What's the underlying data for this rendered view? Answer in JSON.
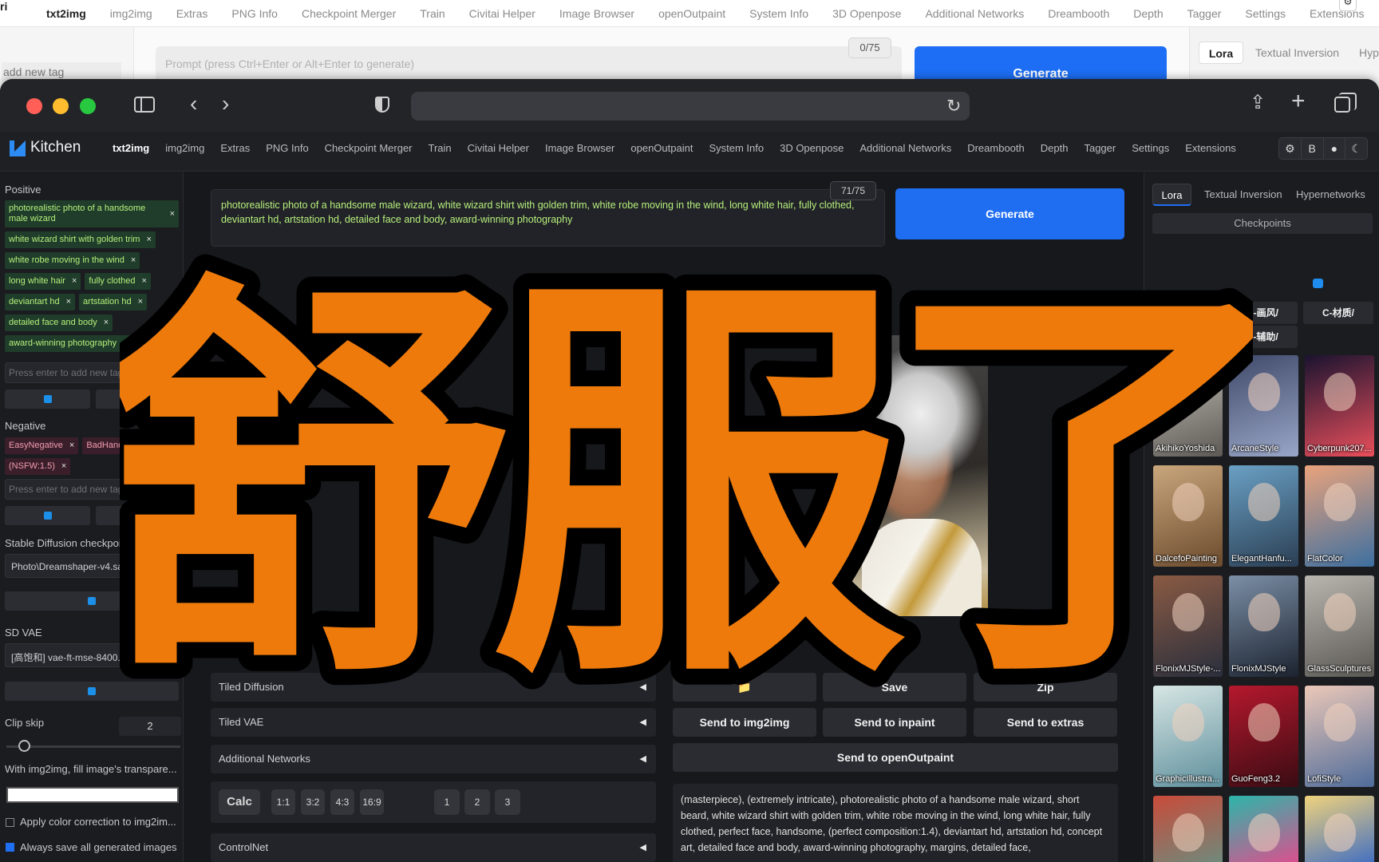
{
  "background_app": {
    "nav_edge": "ri",
    "nav": [
      "txt2img",
      "img2img",
      "Extras",
      "PNG Info",
      "Checkpoint Merger",
      "Train",
      "Civitai Helper",
      "Image Browser",
      "openOutpaint",
      "System Info",
      "3D Openpose",
      "Additional Networks",
      "Dreambooth",
      "Depth",
      "Tagger",
      "Settings",
      "Extensions"
    ],
    "add_tag": "add new tag",
    "prompt_placeholder": "Prompt (press Ctrl+Enter or Alt+Enter to generate)",
    "token_count": "0/75",
    "generate_label": "Generate",
    "tabs": [
      "Lora",
      "Textual Inversion",
      "Hyp"
    ]
  },
  "app": {
    "logo_text": "Kitchen",
    "nav": [
      "txt2img",
      "img2img",
      "Extras",
      "PNG Info",
      "Checkpoint Merger",
      "Train",
      "Civitai Helper",
      "Image Browser",
      "openOutpaint",
      "System Info",
      "3D Openpose",
      "Additional Networks",
      "Dreambooth",
      "Depth",
      "Tagger",
      "Settings",
      "Extensions"
    ],
    "nav_actions": [
      "⚙",
      "B",
      "●",
      "☾"
    ]
  },
  "left_panel": {
    "positive_label": "Positive",
    "positive_tags": [
      "photorealistic photo of a handsome male wizard",
      "white wizard shirt with golden trim",
      "white robe moving in the wind",
      "long white hair",
      "fully clothed",
      "deviantart hd",
      "artstation hd",
      "detailed face and body",
      "award-winning photography"
    ],
    "negative_label": "Negative",
    "negative_tags": [
      "EasyNegative",
      "BadHand",
      "(NSFW:1.5)"
    ],
    "tag_placeholder": "Press enter to add new tag",
    "checkpoint_label": "Stable Diffusion checkpoint",
    "checkpoint_value": "Photo\\Dreamshaper-v4.saf...",
    "vae_label": "SD VAE",
    "vae_value": "[高饱和] vae-ft-mse-8400...",
    "clip_skip_label": "Clip skip",
    "clip_skip_value": "2",
    "clip_skip_fraction": 0.1,
    "fill_label": "With img2img, fill image's transpare...",
    "fill_color": "#ffffff",
    "color_correction_label": "Apply color correction to img2im...",
    "color_correction_checked": false,
    "always_save_label": "Always save all generated images",
    "always_save_checked": true
  },
  "center_panel": {
    "prompt_text": "photorealistic photo of a handsome male wizard, white wizard shirt with golden trim, white robe moving in the wind, long white hair, fully clothed, deviantart hd, artstation hd, detailed face and body, award-winning photography",
    "token_count": "71/75",
    "generate_label": "Generate",
    "sections": [
      "Tiled Diffusion",
      "Tiled VAE",
      "Additional Networks",
      "ControlNet"
    ],
    "calc_label": "Calc",
    "ratio_buttons": [
      "1:1",
      "3:2",
      "4:3",
      "16:9"
    ],
    "number_buttons": [
      "1",
      "2",
      "3"
    ]
  },
  "output": {
    "folder_icon": "📁",
    "save_label": "Save",
    "zip_label": "Zip",
    "send_img2img": "Send to img2img",
    "send_inpaint": "Send to inpaint",
    "send_extras": "Send to extras",
    "send_outpaint": "Send to openOutpaint",
    "info_text": "(masterpiece), (extremely intricate), photorealistic photo of a handsome male wizard, short beard, white wizard shirt with golden trim, white robe moving in the wind, long white hair, fully clothed, perfect face, handsome, (perfect composition:1.4), deviantart hd, artstation hd, concept art, detailed face and body, award-winning photography, margins, detailed face,"
  },
  "right_panel": {
    "tabs": [
      "Lora",
      "Textual Inversion",
      "Hypernetworks"
    ],
    "checkpoints_label": "Checkpoints",
    "chips": [
      "B-画风/",
      "C-材质/",
      "E-辅助/"
    ],
    "cards": [
      "AkihikoYoshida",
      "ArcaneStyle",
      "Cyberpunk207...",
      "DalcefoPainting",
      "ElegantHanfu...",
      "FlatColor",
      "FlonixMJStyle-...",
      "FlonixMJStyle",
      "GlassSculptures",
      "GraphicIllustra...",
      "GuoFeng3.2",
      "LofiStyle",
      "",
      "",
      ""
    ],
    "card_colors": [
      [
        "#c9c4bd",
        "#5d5a55"
      ],
      [
        "#3f4a6a",
        "#9aa6c7"
      ],
      [
        "#1a1330",
        "#e94f5b"
      ],
      [
        "#c9a67c",
        "#6b4b2d"
      ],
      [
        "#6aa0c4",
        "#2b3f54"
      ],
      [
        "#e9a37c",
        "#3d6fa0"
      ],
      [
        "#8a5a43",
        "#2a2f3d"
      ],
      [
        "#7b8fa6",
        "#1c2330"
      ],
      [
        "#b9b6b0",
        "#5a5853"
      ],
      [
        "#d7e6e4",
        "#5e8f9c"
      ],
      [
        "#b5182d",
        "#3a0c13"
      ],
      [
        "#ecc8b8",
        "#4f6c9a"
      ],
      [
        "#c94b3a",
        "#6a8d7f"
      ],
      [
        "#2cb6a9",
        "#e44b8d"
      ],
      [
        "#f0d27c",
        "#3b6bc4"
      ]
    ]
  },
  "overlay": {
    "title": "舒服了",
    "fill": "#ee7a0b",
    "stroke": "#000000"
  }
}
